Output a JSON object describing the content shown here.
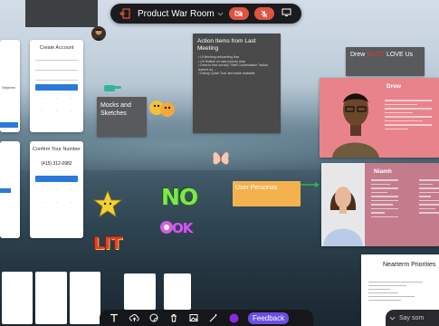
{
  "toolbar": {
    "room_name": "Product War Room",
    "icons": [
      "exit-icon",
      "chevron-down-icon",
      "camera-off-icon",
      "mic-off-icon",
      "screen-share-icon"
    ]
  },
  "phones": {
    "create_account": {
      "title": "Create Account",
      "button": ""
    },
    "confirm_number": {
      "title": "Confirm Your Number",
      "code": "(415) 312-0982",
      "button": ""
    }
  },
  "notes": {
    "action_items": {
      "title": "Action Items from Last Meeting",
      "lines": [
        "• UI finishing onboarding flow",
        "• UX finalize on user journey map",
        "• Drew to find out why \"Start Conversation\" button doesn't on ...",
        "• Debug 'Quick Tour' and make available"
      ]
    },
    "mocks": {
      "title": "Mocks and Sketches"
    },
    "user_personas": {
      "title": "User Personas"
    },
    "drew_must": {
      "prefix": "Drew ",
      "emphasis": "MUST",
      "suffix": " LOVE Us"
    }
  },
  "personas": {
    "drew": {
      "name": "Drew"
    },
    "niamh": {
      "name": "Niamh"
    }
  },
  "nearterm": {
    "title": "Nearterm Priorities"
  },
  "stickers": {
    "no": "NO",
    "ok": "OK",
    "lit": "LIT"
  },
  "bottom_toolbar": {
    "feedback_label": "Feedback",
    "say_something": "Say som",
    "icons": [
      "text-icon",
      "upload-icon",
      "sticker-icon",
      "delete-icon",
      "image-icon",
      "magic-icon",
      "color-swatch-icon"
    ]
  },
  "colors": {
    "accent_red": "#e0533f",
    "feedback_purple": "#6b4fe0",
    "persona_pink": "#e9838b",
    "note_orange": "#f4b24e",
    "must_red": "#e23b3b"
  }
}
